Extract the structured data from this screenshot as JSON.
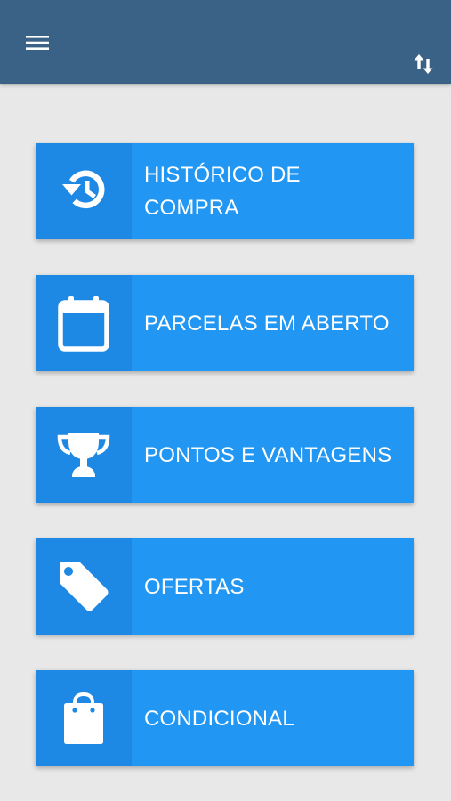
{
  "header": {
    "menu_icon": "hamburger-menu-icon",
    "sort_icon": "swap-vertical-icon",
    "background_color": "#3a6186"
  },
  "menu": {
    "items": [
      {
        "label": "HISTÓRICO DE COMPRA",
        "icon": "history-icon"
      },
      {
        "label": "PARCELAS EM ABERTO",
        "icon": "calendar-icon"
      },
      {
        "label": "PONTOS E VANTAGENS",
        "icon": "trophy-icon"
      },
      {
        "label": "OFERTAS",
        "icon": "tag-icon"
      },
      {
        "label": "CONDICIONAL",
        "icon": "shopping-bag-icon"
      }
    ],
    "card_color": "#2196f3",
    "icon_box_color": "#1e88e5"
  }
}
